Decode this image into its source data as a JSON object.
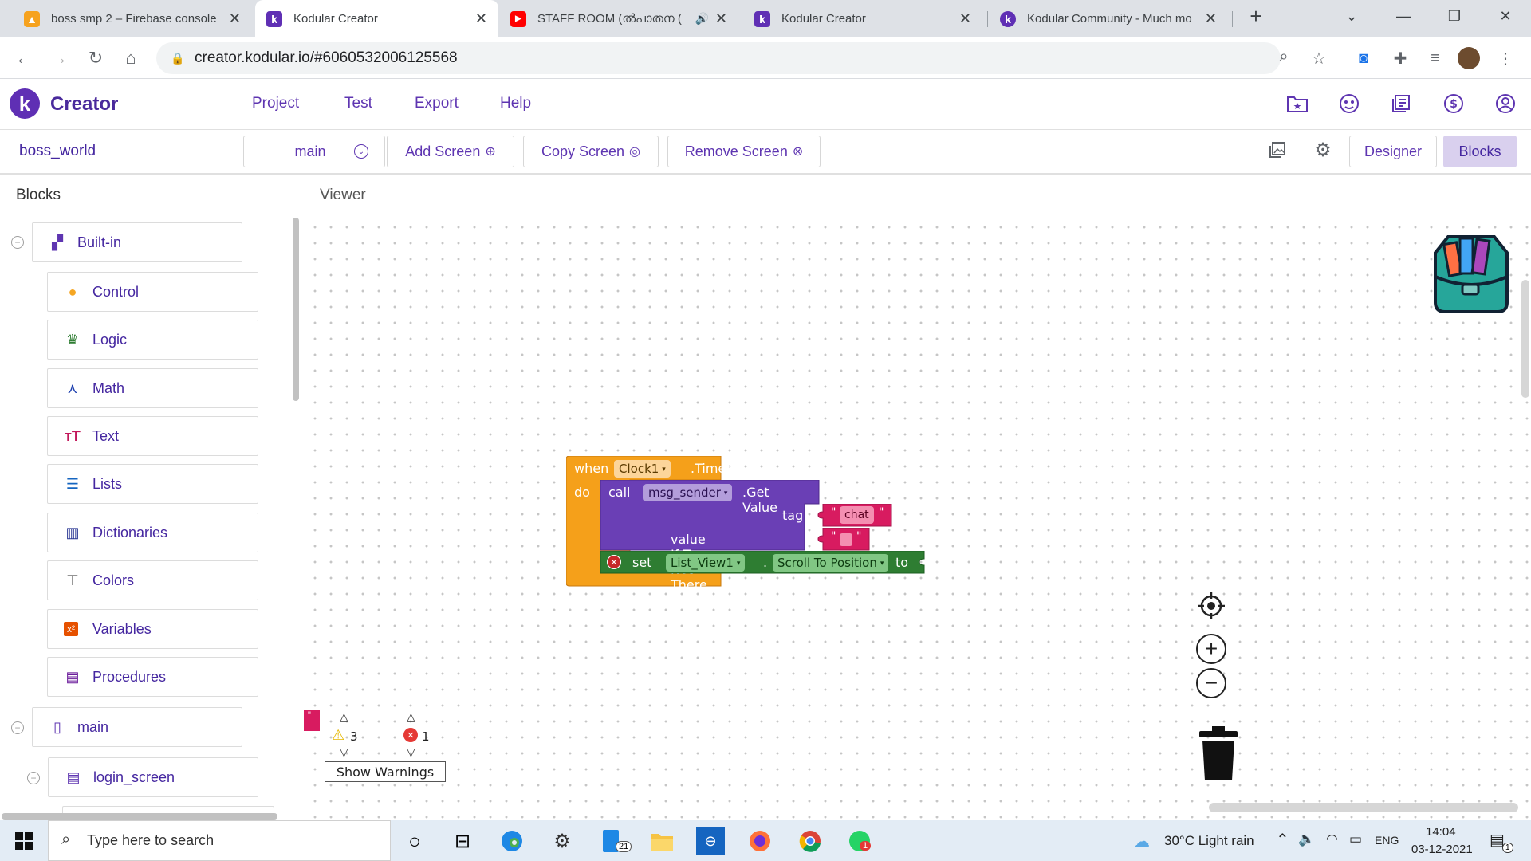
{
  "browser": {
    "tabs": [
      {
        "title": "boss smp 2 – Firebase console",
        "favicon": "firebase-icon",
        "color": "#f6a21e"
      },
      {
        "title": "Kodular Creator",
        "favicon": "kodular-icon",
        "color": "#5f2fb4"
      },
      {
        "title": "STAFF ROOM (ൽപാതന (",
        "favicon": "youtube-icon",
        "color": "#ff0000"
      },
      {
        "title": "Kodular Creator",
        "favicon": "kodular-icon",
        "color": "#5f2fb4"
      },
      {
        "title": "Kodular Community - Much mo",
        "favicon": "kodular-community-icon",
        "color": "#5f2fb4"
      }
    ],
    "url": "creator.kodular.io/#6060532006125568"
  },
  "header": {
    "brand": "Creator",
    "menu": [
      "Project",
      "Test",
      "Export",
      "Help"
    ]
  },
  "toolbar": {
    "project_name": "boss_world",
    "screen_select": "main",
    "add_screen": "Add Screen",
    "copy_screen": "Copy Screen",
    "remove_screen": "Remove Screen",
    "designer": "Designer",
    "blocks": "Blocks"
  },
  "blocks_panel": {
    "title": "Blocks",
    "builtin_label": "Built-in",
    "builtin_items": [
      {
        "label": "Control",
        "icon": "control-icon",
        "color": "#f5a623"
      },
      {
        "label": "Logic",
        "icon": "logic-icon",
        "color": "#2e7d32"
      },
      {
        "label": "Math",
        "icon": "math-icon",
        "color": "#1e40af"
      },
      {
        "label": "Text",
        "icon": "text-icon",
        "color": "#c2185b"
      },
      {
        "label": "Lists",
        "icon": "lists-icon",
        "color": "#1565c0"
      },
      {
        "label": "Dictionaries",
        "icon": "dictionaries-icon",
        "color": "#283593"
      },
      {
        "label": "Colors",
        "icon": "colors-icon",
        "color": "#555555"
      },
      {
        "label": "Variables",
        "icon": "variables-icon",
        "color": "#e65100"
      },
      {
        "label": "Procedures",
        "icon": "procedures-icon",
        "color": "#6a1b9a"
      }
    ],
    "screen_label": "main",
    "component_label": "login_screen"
  },
  "viewer": {
    "title": "Viewer",
    "event_block": {
      "when": "when",
      "component": "Clock1",
      "event": ".Timer",
      "do": "do"
    },
    "call_block": {
      "call": "call",
      "component": "msg_sender",
      "method": ".Get Value",
      "tag_label": "tag",
      "tag_value": "chat",
      "value_label": "value If Tag Not There"
    },
    "set_block": {
      "set": "set",
      "component": "List_View1",
      "property": "Scroll To Position",
      "to": "to"
    },
    "warnings": {
      "warning_count": "3",
      "error_count": "1",
      "show_warnings": "Show Warnings"
    }
  },
  "taskbar": {
    "search_placeholder": "Type here to search",
    "edge_badge": "21",
    "whatsapp_badge": "1",
    "weather": "30°C  Light rain",
    "lang": "ENG",
    "time": "14:04",
    "date": "03-12-2021",
    "notif_badge": "1"
  }
}
